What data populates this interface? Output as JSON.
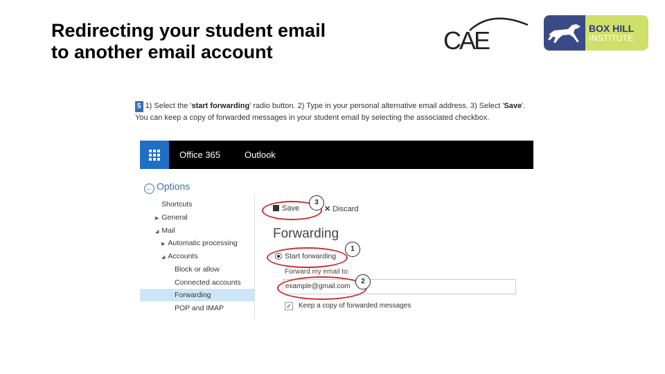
{
  "slide": {
    "title_line1": "Redirecting your student email",
    "title_line2": "to another email account"
  },
  "logos": {
    "cae": "CAE",
    "bhi_line1": "BOX HILL",
    "bhi_line2": "INSTITUTE"
  },
  "instructions": {
    "step": "5",
    "part1": "1) Select the '",
    "bold1": "start forwarding",
    "part2": "' radio button. 2) Type in your personal alternative email address. 3) Select '",
    "bold2": "Save",
    "part3": "'. You can keep a copy of forwarded messages in your student email by selecting the associated checkbox."
  },
  "topbar": {
    "app_name": "Office 365",
    "module": "Outlook"
  },
  "nav": {
    "header": "Options",
    "items": [
      {
        "label": "Shortcuts"
      },
      {
        "label": "General"
      },
      {
        "label": "Mail"
      },
      {
        "label": "Automatic processing"
      },
      {
        "label": "Accounts"
      },
      {
        "label": "Block or allow"
      },
      {
        "label": "Connected accounts"
      },
      {
        "label": "Forwarding"
      },
      {
        "label": "POP and IMAP"
      }
    ],
    "selected": "Forwarding"
  },
  "actions": {
    "save_label": "Save",
    "discard_label": "Discard"
  },
  "forwarding": {
    "title": "Forwarding",
    "radio_label": "Start forwarding",
    "field_label": "Forward my email to:",
    "field_value": "example@gmail.com",
    "checkbox_label": "Keep a copy of forwarded messages",
    "checkbox_checked": true
  },
  "callouts": [
    "1",
    "2",
    "3"
  ],
  "colors": {
    "accent_blue": "#1f6fc5",
    "callout_ring": "#d12a2a",
    "bhi_navy": "#3a4a86",
    "bhi_green": "#cfe06a"
  }
}
